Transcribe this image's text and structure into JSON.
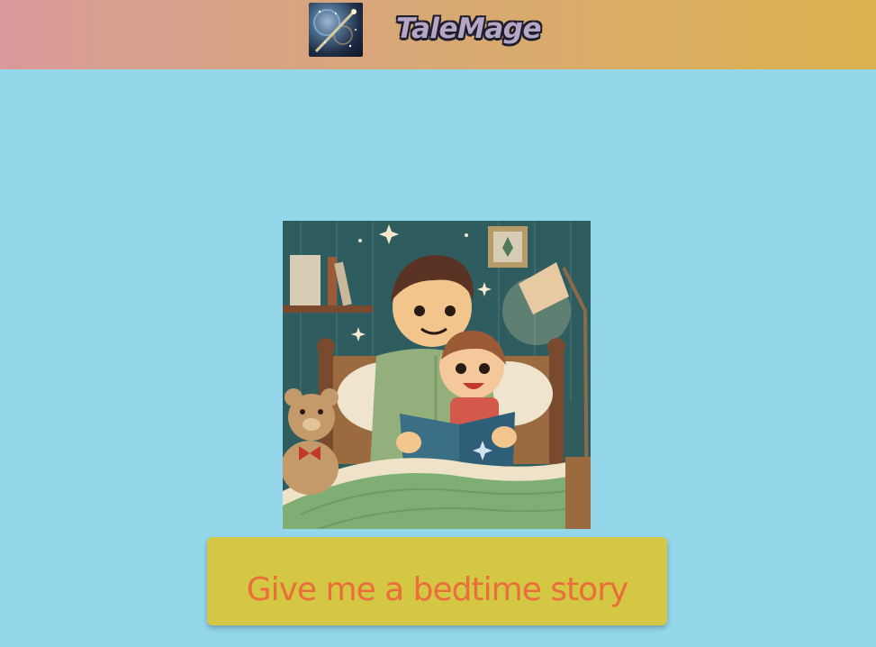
{
  "header": {
    "logo_icon": "magic-wand-galaxy-icon",
    "brand_name": "TaleMage"
  },
  "main": {
    "illustration": "father-reading-bedtime-story-illustration",
    "story_button_label": "Give me a bedtime story"
  },
  "colors": {
    "page_background": "#94d6ea",
    "header_gradient_start": "#d89a9a",
    "header_gradient_end": "#dcb24f",
    "button_background": "#d4c744",
    "button_text": "#ea6d3a"
  }
}
